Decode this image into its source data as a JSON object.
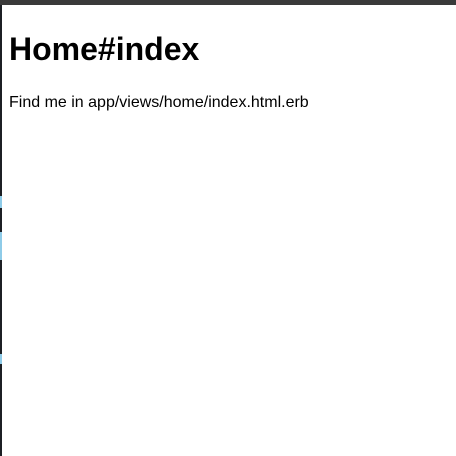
{
  "page": {
    "title": "Home#index",
    "message": "Find me in app/views/home/index.html.erb"
  },
  "colors": {
    "background": "#ffffff",
    "text": "#000000",
    "top_bar": "#3a3a3a",
    "left_edge": "#1c1f24",
    "edge_marks": "#8ecbe8"
  }
}
